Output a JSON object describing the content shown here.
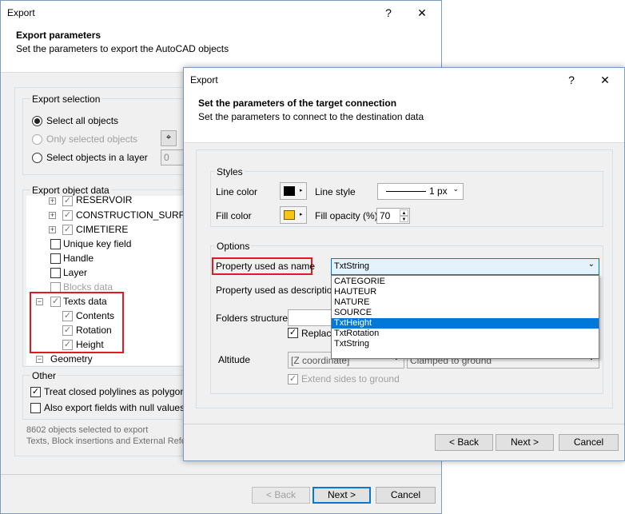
{
  "back_window": {
    "title": "Export",
    "help_btn": "?",
    "close_btn": "✕",
    "heading": "Export parameters",
    "subheading": "Set the parameters to export the AutoCAD objects",
    "export_selection": {
      "label": "Export selection",
      "select_all": "Select all objects",
      "only_selected": "Only selected objects",
      "select_layer": "Select objects in a layer",
      "layer_value": "0"
    },
    "export_object_data": {
      "label": "Export object data",
      "items": {
        "reservoir": "RESERVOIR",
        "construction": "CONSTRUCTION_SURFACE",
        "cimetiere": "CIMETIERE",
        "unique_key": "Unique key field",
        "handle": "Handle",
        "layer": "Layer",
        "blocks_data": "Blocks data",
        "texts_data": "Texts data",
        "contents": "Contents",
        "rotation": "Rotation",
        "height": "Height",
        "geometry": "Geometry"
      }
    },
    "other": {
      "label": "Other",
      "closed_polylines": "Treat closed polylines as polygons",
      "null_values": "Also export fields with null values"
    },
    "status_line1": "8602 objects selected to export",
    "status_line2": "Texts, Block insertions and External References",
    "buttons": {
      "back": "< Back",
      "next": "Next >",
      "cancel": "Cancel"
    }
  },
  "front_window": {
    "title": "Export",
    "help_btn": "?",
    "close_btn": "✕",
    "heading": "Set the parameters of the target connection",
    "subheading": "Set the parameters to connect to the destination data",
    "styles": {
      "label": "Styles",
      "line_color": "Line color",
      "line_style": "Line style",
      "line_style_value": "1 px",
      "fill_color": "Fill color",
      "fill_opacity": "Fill opacity (%)",
      "fill_opacity_value": "70",
      "line_color_hex": "#000000",
      "fill_color_hex": "#f5c518"
    },
    "options": {
      "label": "Options",
      "property_name": "Property used as name",
      "property_name_value": "TxtString",
      "property_description": "Property used as description",
      "folders_structure": "Folders structure",
      "replace": "Replace",
      "altitude": "Altitude",
      "altitude_mode": "[Z coordinate]",
      "altitude_clamp": "Clamped to ground",
      "extend_sides": "Extend sides to ground",
      "dropdown_options": [
        "CATEGORIE",
        "HAUTEUR",
        "NATURE",
        "SOURCE",
        "TxtHeight",
        "TxtRotation",
        "TxtString"
      ],
      "dropdown_selected_index": 4
    },
    "buttons": {
      "back": "< Back",
      "next": "Next >",
      "cancel": "Cancel"
    }
  },
  "colors": {
    "accent": "#0078d7",
    "highlight_red": "#e01a22",
    "selected_bg": "#0078d7"
  }
}
